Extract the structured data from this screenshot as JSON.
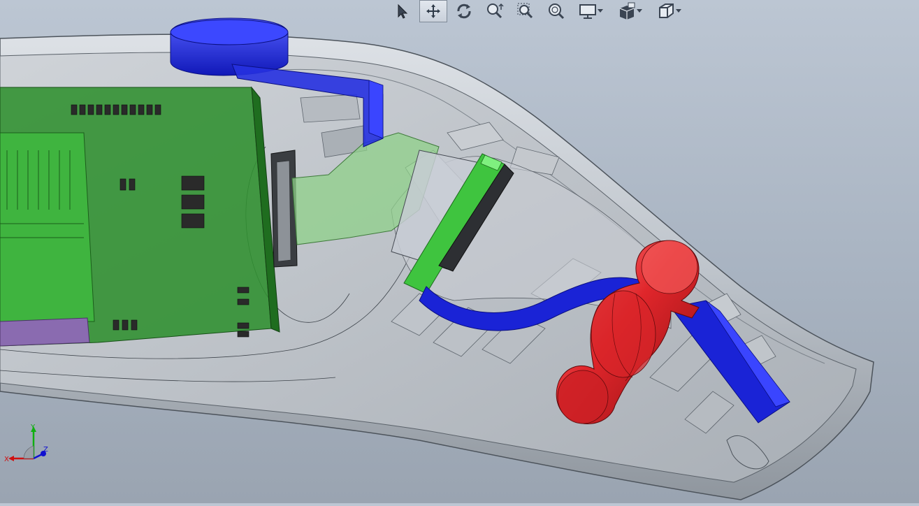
{
  "window": {
    "title": ""
  },
  "toolbar": {
    "buttons": [
      {
        "id": "select",
        "icon": "select-arrow-icon"
      },
      {
        "id": "pan",
        "icon": "pan-move-icon",
        "active": true
      },
      {
        "id": "rotate",
        "icon": "rotate-view-icon"
      },
      {
        "id": "zoom-in-out",
        "icon": "zoom-in-out-icon"
      },
      {
        "id": "zoom-to-area",
        "icon": "zoom-to-area-icon"
      },
      {
        "id": "zoom-to-fit",
        "icon": "zoom-to-fit-icon"
      },
      {
        "id": "display-style",
        "icon": "display-style-icon",
        "dropdown": true
      },
      {
        "id": "view-settings",
        "icon": "view-settings-icon",
        "dropdown": true
      },
      {
        "id": "view-orientation",
        "icon": "view-orientation-cube-icon",
        "dropdown": true
      }
    ]
  },
  "triad": {
    "x_label": "X",
    "y_label": "Y",
    "z_label": "Z"
  },
  "colors": {
    "background_top": "#bcc6d3",
    "background_bottom": "#9aa4b1",
    "shell": "#c3c9d0",
    "pcb_green": "#2ea52e",
    "flex_cable": "#8fd08a",
    "blue_parts": "#1a23d6",
    "red_part": "#e0262b",
    "x_axis": "#d01010",
    "y_axis": "#10b010",
    "z_axis": "#1010d0"
  }
}
